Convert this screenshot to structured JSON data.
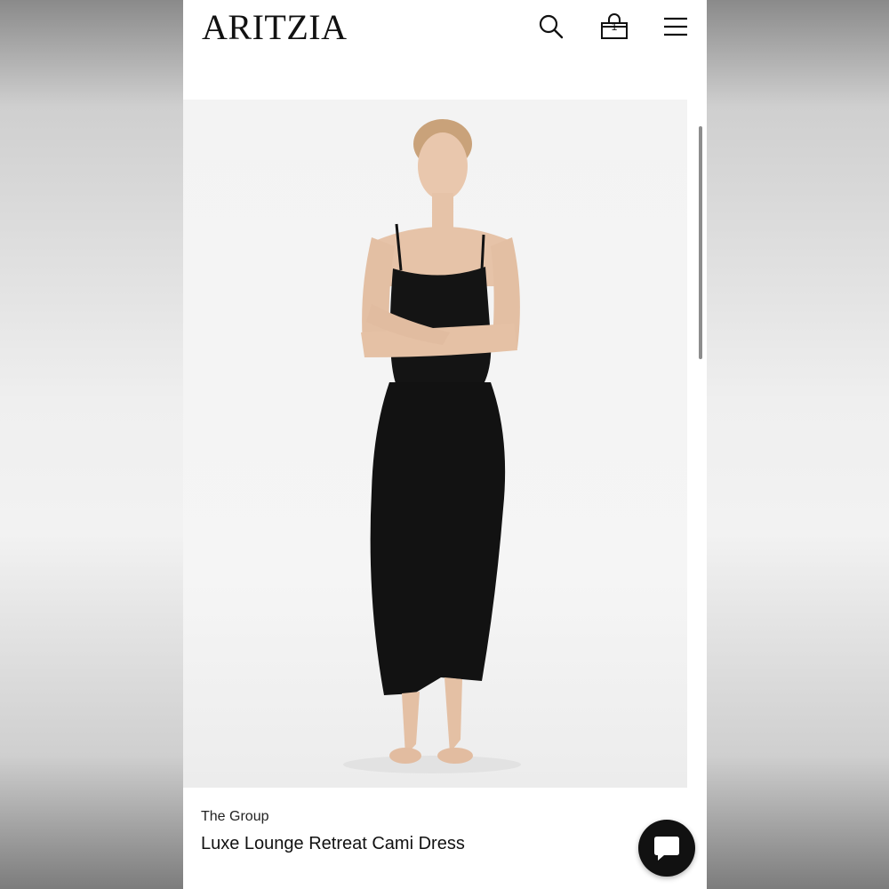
{
  "header": {
    "logo": "ARITZIA",
    "icons": [
      "search-icon",
      "shopping-bag-icon",
      "menu-icon"
    ],
    "bag_count": "1"
  },
  "hero": {
    "image": "model wearing black cami maxi dress"
  },
  "product": {
    "brand": "The Group",
    "title": "Luxe Lounge Retreat Cami Dress"
  },
  "chat": {
    "icon": "chat-icon"
  },
  "colors": {
    "background": "#ffffff",
    "text": "#111111",
    "dress": "#121212",
    "skin": "#e6c3a8"
  }
}
